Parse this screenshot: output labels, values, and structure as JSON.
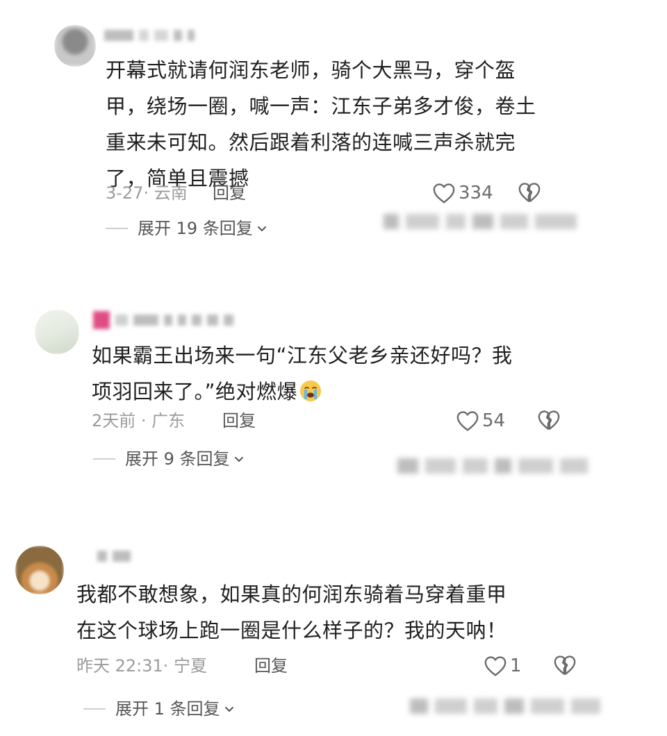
{
  "comments": [
    {
      "text_lines": [
        "开幕式就请何润东老师，骑个大黑马，穿个盔",
        "甲，绕场一圈，喊一声：江东子弟多才俊，卷土",
        "重来未可知。然后跟着利落的连喊三声杀就完",
        "了，简单且震撼"
      ],
      "date_location": "3-27· 云南",
      "reply_label": "回复",
      "like_count": "334",
      "expand_label": "展开 19 条回复"
    },
    {
      "text_lines": [
        "如果霸王出场来一句“江东父老乡亲还好吗？我",
        "项羽回来了。”绝对燃爆"
      ],
      "date_location": "2天前 · 广东",
      "reply_label": "回复",
      "like_count": "54",
      "expand_label": "展开 9 条回复"
    },
    {
      "text_lines": [
        "我都不敢想象，如果真的何润东骑着马穿着重甲",
        "在这个球场上跑一圈是什么样子的？我的天呐！"
      ],
      "date_location": "昨天 22:31· 宁夏",
      "reply_label": "回复",
      "like_count": "1",
      "expand_label": "展开 1 条回复"
    }
  ],
  "icons": {
    "like": "heart-outline-icon",
    "dislike": "broken-heart-icon",
    "expand": "chevron-down-icon",
    "emoji": "crying-face-emoji"
  },
  "colors": {
    "text": "#1f1f1f",
    "meta": "#9b9b9b",
    "action": "#555555"
  }
}
